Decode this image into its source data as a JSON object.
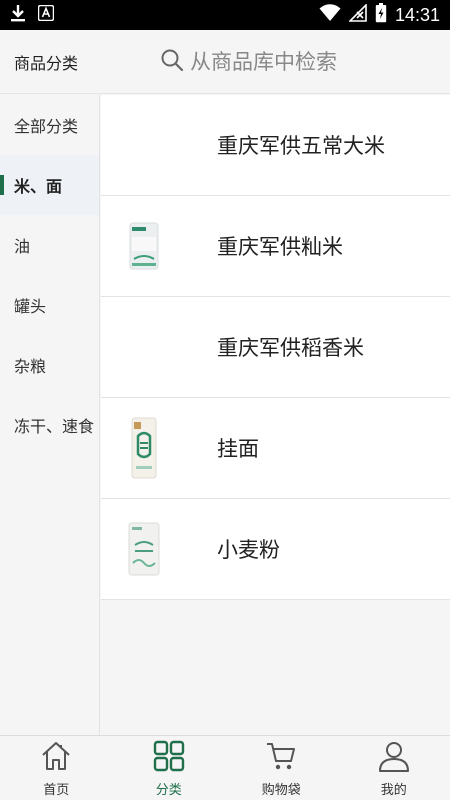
{
  "status_bar": {
    "time": "14:31",
    "icons": [
      "download-icon",
      "notification-a-icon",
      "wifi-icon",
      "no-signal-icon",
      "battery-charging-icon"
    ]
  },
  "header": {
    "title": "商品分类",
    "search_placeholder": "从商品库中检索"
  },
  "sidebar": {
    "items": [
      {
        "label": "全部分类",
        "active": false
      },
      {
        "label": "米、面",
        "active": true
      },
      {
        "label": "油",
        "active": false
      },
      {
        "label": "罐头",
        "active": false
      },
      {
        "label": "杂粮",
        "active": false
      },
      {
        "label": "冻干、速食",
        "active": false
      }
    ]
  },
  "products": [
    {
      "name": "重庆军供五常大米",
      "has_image": false
    },
    {
      "name": "重庆军供籼米",
      "has_image": true,
      "image": "rice-bag"
    },
    {
      "name": "重庆军供稻香米",
      "has_image": false
    },
    {
      "name": "挂面",
      "has_image": true,
      "image": "noodle-box"
    },
    {
      "name": "小麦粉",
      "has_image": true,
      "image": "flour-bag"
    }
  ],
  "bottom_nav": {
    "tabs": [
      {
        "label": "首页",
        "icon": "home-icon",
        "active": false
      },
      {
        "label": "分类",
        "icon": "category-grid-icon",
        "active": true
      },
      {
        "label": "购物袋",
        "icon": "cart-icon",
        "active": false
      },
      {
        "label": "我的",
        "icon": "user-icon",
        "active": false
      }
    ]
  },
  "colors": {
    "accent": "#1f6f4a",
    "background": "#f5f5f5",
    "card": "#ffffff"
  }
}
